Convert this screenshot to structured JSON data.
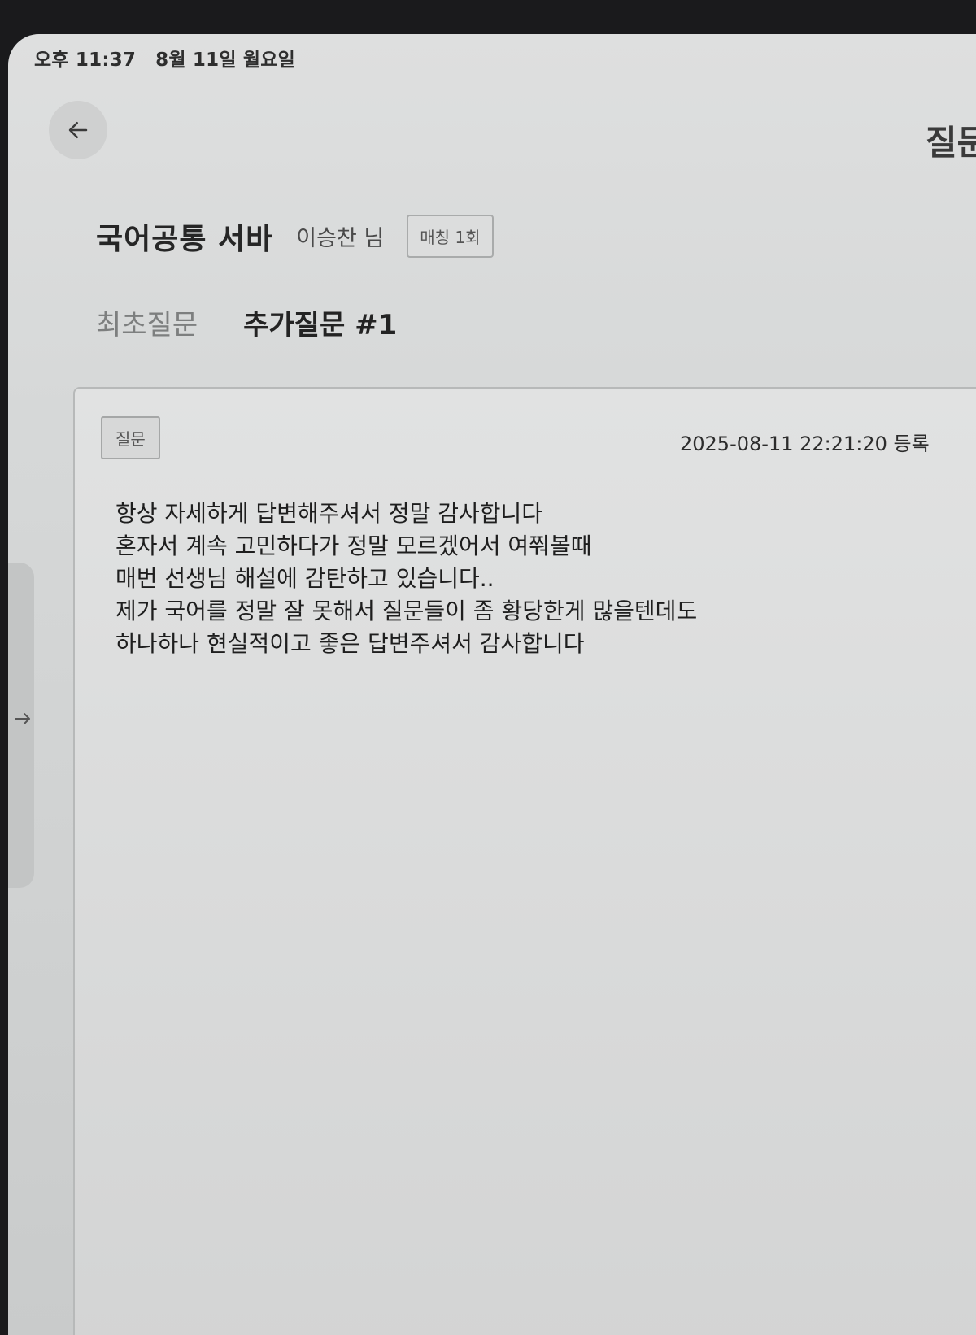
{
  "status_bar": {
    "time": "오후 11:37",
    "date": "8월 11일 월요일"
  },
  "header": {
    "page_title_partial": "질문",
    "course_title": "국어공통 서바",
    "teacher_name": "이승찬 님",
    "match_badge": "매칭 1회"
  },
  "tabs": [
    {
      "label": "최초질문",
      "active": false
    },
    {
      "label": "추가질문 #1",
      "active": true
    }
  ],
  "question_card": {
    "label": "질문",
    "timestamp": "2025-08-11 22:21:20 등록",
    "body_lines": [
      "항상 자세하게 답변해주셔서 정말 감사합니다",
      "혼자서 계속 고민하다가 정말 모르겠어서 여쭤볼때",
      "매번 선생님 해설에 감탄하고 있습니다..",
      "제가 국어를 정말 잘 못해서 질문들이 좀 황당한게 많을텐데도",
      "하나하나 현실적이고 좋은 답변주셔서 감사합니다"
    ]
  },
  "icons": {
    "back": "arrow-left-icon",
    "side": "arrow-right-icon"
  }
}
